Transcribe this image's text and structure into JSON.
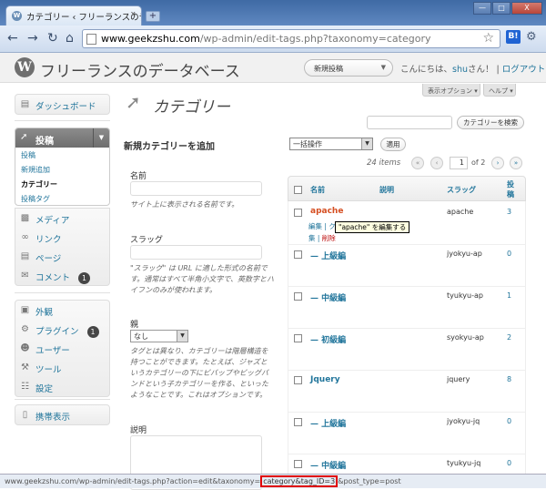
{
  "browser": {
    "tab_title": "カテゴリー ‹ フリーランスのデ…",
    "tab_close": "x",
    "new_tab": "+",
    "win_minimize": "—",
    "win_maximize": "□",
    "win_close": "X",
    "url_host": "www.geekzshu.com",
    "url_path": "/wp-admin/edit-tags.php?taxonomy=category",
    "ext_label": "B!"
  },
  "header": {
    "logo": "W",
    "site_title": "フリーランスのデータベース",
    "favorite_select": "新規投稿",
    "greeting_prefix": "こんにちは、",
    "username": "shu",
    "greeting_suffix": "さん！",
    "separator": " | ",
    "logout": "ログアウト",
    "screen_options": "表示オプション ▾",
    "help": "ヘルプ ▾"
  },
  "sidebar": {
    "dashboard": "ダッシュボード",
    "posts": "投稿",
    "posts_sub": [
      "投稿",
      "新規追加",
      "カテゴリー",
      "投稿タグ"
    ],
    "media": "メディア",
    "links": "リンク",
    "pages": "ページ",
    "comments": "コメント",
    "comments_badge": "1",
    "appearance": "外観",
    "plugins": "プラグイン",
    "plugins_badge": "1",
    "users": "ユーザー",
    "tools": "ツール",
    "settings": "設定",
    "mobile": "携帯表示"
  },
  "page": {
    "title": "カテゴリー",
    "search_button": "カテゴリーを検索",
    "add_heading": "新規カテゴリーを追加",
    "name_label": "名前",
    "name_help": "サイト上に表示される名前です。",
    "slug_label": "スラッグ",
    "slug_help": "\"スラッグ\" は URL に適した形式の名前です。通常はすべて半角小文字で、英数字とハイフンのみが使われます。",
    "parent_label": "親",
    "parent_value": "なし",
    "parent_help": "タグとは異なり、カテゴリーは階層構造を持つことができます。たとえば、ジャズというカテゴリーの下にビバップやビッグバンドという子カテゴリーを作る、といったようなことです。これはオプションです。",
    "desc_label": "説明"
  },
  "table": {
    "bulk_action": "一括操作",
    "apply": "適用",
    "item_count": "24 items",
    "page_first": "«",
    "page_prev": "‹",
    "page_current": "1",
    "page_of": "of 2",
    "page_next": "›",
    "page_last": "»",
    "col_name": "名前",
    "col_desc": "説明",
    "col_slug": "スラッグ",
    "col_posts": "投稿",
    "rows": [
      {
        "name": "apache",
        "slug": "apache",
        "count": "3"
      },
      {
        "name": "— 上級編",
        "slug": "jyokyu-ap",
        "count": "0"
      },
      {
        "name": "— 中級編",
        "slug": "tyukyu-ap",
        "count": "1"
      },
      {
        "name": "— 初級編",
        "slug": "syokyu-ap",
        "count": "2"
      },
      {
        "name": "Jquery",
        "slug": "jquery",
        "count": "8"
      },
      {
        "name": "— 上級編",
        "slug": "jyokyu-jq",
        "count": "0"
      },
      {
        "name": "— 中級編",
        "slug": "tyukyu-jq",
        "count": "0"
      }
    ],
    "row_action_edit": "編集",
    "row_action_sep": " | ",
    "row_action_quick": "ク",
    "row_action_quick2": "集",
    "row_action_delete": "削除",
    "tooltip": "\"apache\" を編集する"
  },
  "status": {
    "url_prefix": "www.geekzshu.com/wp-admin/edit-tags.php?action=edit&taxonomy=",
    "url_highlight": "category&tag_ID=3",
    "url_suffix": "&post_type=post"
  }
}
